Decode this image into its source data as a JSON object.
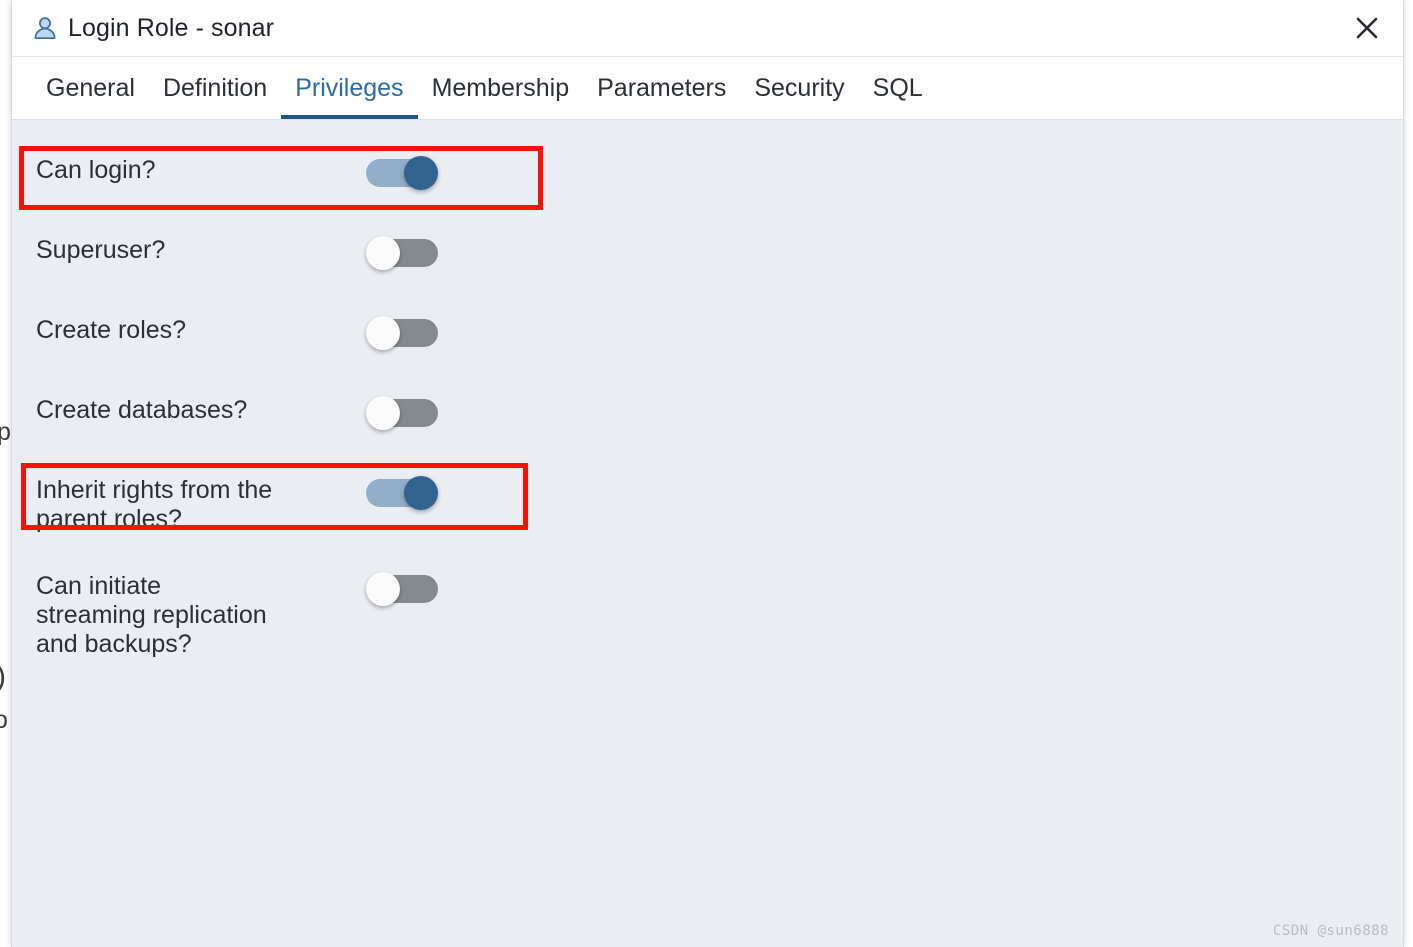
{
  "window": {
    "title": "Login Role - sonar",
    "title_icon": "user-icon",
    "close_icon": "close-icon"
  },
  "tabs": [
    {
      "label": "General",
      "active": false
    },
    {
      "label": "Definition",
      "active": false
    },
    {
      "label": "Privileges",
      "active": true
    },
    {
      "label": "Membership",
      "active": false
    },
    {
      "label": "Parameters",
      "active": false
    },
    {
      "label": "Security",
      "active": false
    },
    {
      "label": "SQL",
      "active": false
    }
  ],
  "privileges": [
    {
      "label": "Can login?",
      "state": "on",
      "highlighted": true
    },
    {
      "label": "Superuser?",
      "state": "off",
      "highlighted": false
    },
    {
      "label": "Create roles?",
      "state": "off",
      "highlighted": false
    },
    {
      "label": "Create databases?",
      "state": "off",
      "highlighted": false
    },
    {
      "label": "Inherit rights from the\nparent roles?",
      "state": "on",
      "highlighted": true
    },
    {
      "label": "Can initiate\nstreaming replication\nand backups?",
      "state": "off",
      "highlighted": false
    }
  ],
  "background_fragments": [
    {
      "text": "p"
    },
    {
      "text": ")"
    },
    {
      "text": "o"
    }
  ],
  "watermark": "CSDN @sun6888",
  "colors": {
    "accent": "#2e6b9e",
    "tab_underline": "#1d5480",
    "toggle_on_track": "#93aec8",
    "toggle_on_knob": "#31638f",
    "toggle_off_track": "#858a90",
    "highlight": "#fc1108",
    "content_bg": "#eaedf2"
  }
}
